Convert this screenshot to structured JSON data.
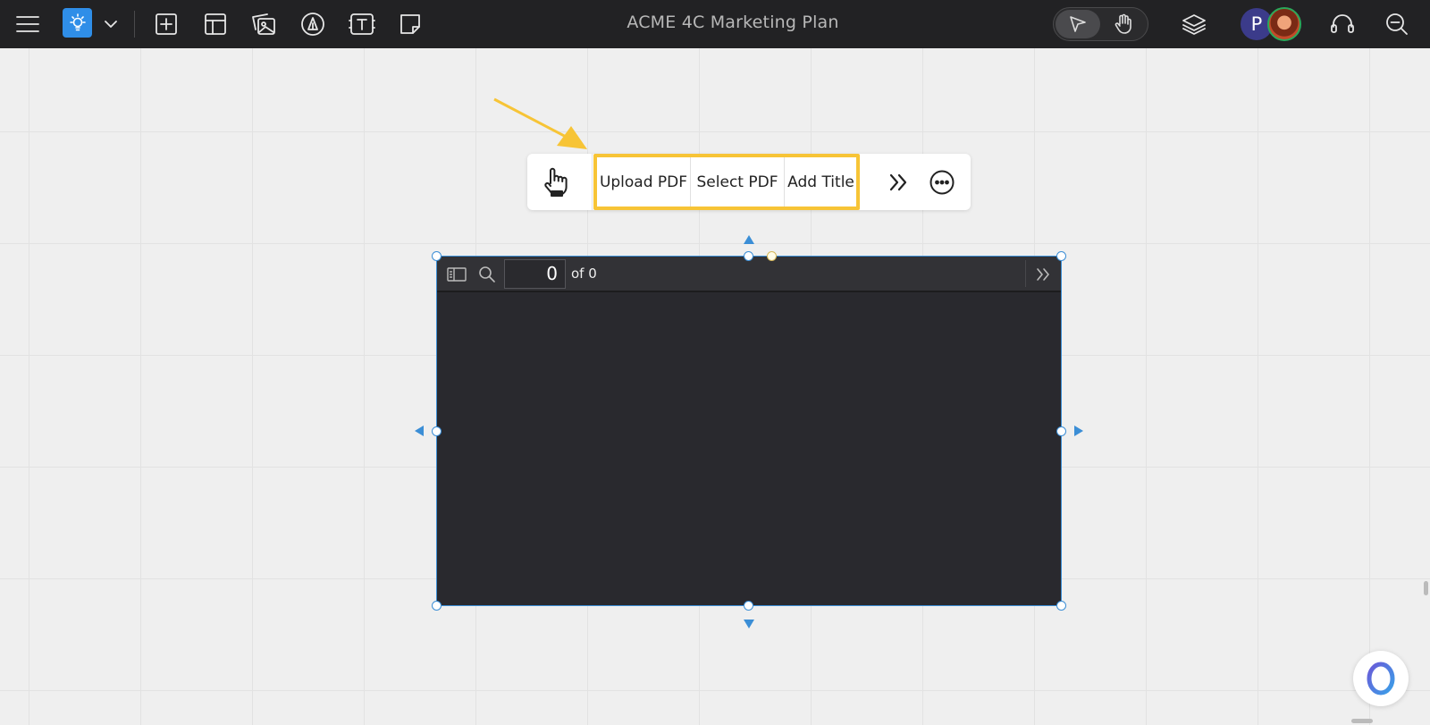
{
  "app": {
    "title": "ACME 4C Marketing Plan"
  },
  "topbar": {
    "avatar_initial": "P",
    "accent_color": "#2f8ee8",
    "icons": [
      "menu-icon",
      "lightbulb-icon",
      "chevron-down-icon",
      "add-frame-icon",
      "template-icon",
      "media-icon",
      "pen-icon",
      "text-icon",
      "sticky-note-icon",
      "select-pointer-icon",
      "pan-hand-icon",
      "layers-icon",
      "headset-icon",
      "search-zoom-icon"
    ]
  },
  "float_toolbar": {
    "upload_label": "Upload PDF",
    "select_label": "Select PDF",
    "title_label": "Add Title",
    "highlight_color": "#f7c436"
  },
  "pdf_viewer": {
    "page_value": "0",
    "page_total_text": "of 0"
  }
}
